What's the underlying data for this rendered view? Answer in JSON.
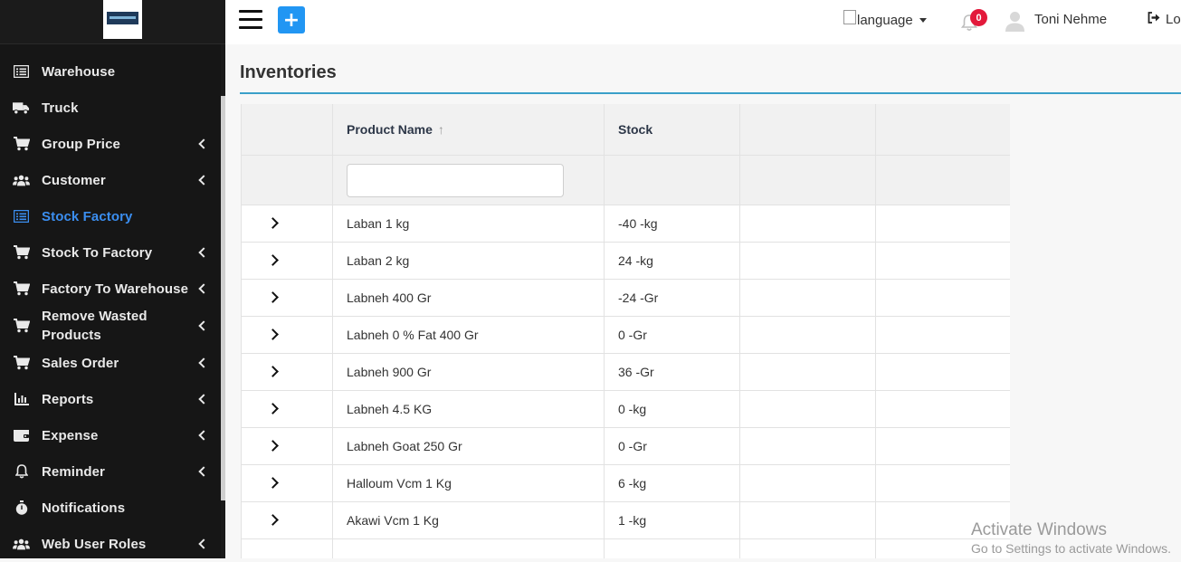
{
  "sidebar": {
    "items": [
      {
        "label": "Warehouse",
        "icon": "warehouse-icon",
        "has_submenu": false,
        "active": false
      },
      {
        "label": "Truck",
        "icon": "truck-icon",
        "has_submenu": false,
        "active": false
      },
      {
        "label": "Group Price",
        "icon": "cart-icon",
        "has_submenu": true,
        "active": false
      },
      {
        "label": "Customer",
        "icon": "users-icon",
        "has_submenu": true,
        "active": false
      },
      {
        "label": "Stock Factory",
        "icon": "list-icon",
        "has_submenu": false,
        "active": true
      },
      {
        "label": "Stock To Factory",
        "icon": "cart-icon",
        "has_submenu": true,
        "active": false
      },
      {
        "label": "Factory To Warehouse",
        "icon": "cart-icon",
        "has_submenu": true,
        "active": false
      },
      {
        "label": "Remove Wasted Products",
        "icon": "cart-icon",
        "has_submenu": true,
        "active": false
      },
      {
        "label": "Sales Order",
        "icon": "cart-icon",
        "has_submenu": true,
        "active": false
      },
      {
        "label": "Reports",
        "icon": "chart-icon",
        "has_submenu": true,
        "active": false
      },
      {
        "label": "Expense",
        "icon": "wallet-icon",
        "has_submenu": true,
        "active": false
      },
      {
        "label": "Reminder",
        "icon": "bell-icon",
        "has_submenu": true,
        "active": false
      },
      {
        "label": "Notifications",
        "icon": "stopwatch-icon",
        "has_submenu": false,
        "active": false
      },
      {
        "label": "Web User Roles",
        "icon": "users-icon",
        "has_submenu": true,
        "active": false
      }
    ]
  },
  "header": {
    "add_label": "+",
    "language_alt": "language",
    "notification_count": "0",
    "username": "Toni Nehme",
    "logout_label": "Lo"
  },
  "page": {
    "title": "Inventories"
  },
  "table": {
    "columns": [
      "",
      "Product Name",
      "Stock",
      "",
      ""
    ],
    "sort_indicator": "↑",
    "filter_value": "",
    "rows": [
      {
        "name": "Laban 1 kg",
        "stock": "-40 -kg"
      },
      {
        "name": "Laban 2 kg",
        "stock": "24 -kg"
      },
      {
        "name": "Labneh 400 Gr",
        "stock": "-24 -Gr"
      },
      {
        "name": "Labneh 0 % Fat 400 Gr",
        "stock": "0 -Gr"
      },
      {
        "name": "Labneh 900 Gr",
        "stock": "36 -Gr"
      },
      {
        "name": "Labneh 4.5 KG",
        "stock": "0 -kg"
      },
      {
        "name": "Labneh Goat 250 Gr",
        "stock": "0 -Gr"
      },
      {
        "name": "Halloum Vcm 1 Kg",
        "stock": "6 -kg"
      },
      {
        "name": "Akawi Vcm 1 Kg",
        "stock": "1 -kg"
      }
    ]
  },
  "watermark": {
    "line1": "Activate Windows",
    "line2": "Go to Settings to activate Windows."
  },
  "colors": {
    "sidebar_bg": "#161616",
    "active": "#3b8ef0",
    "add_button": "#2196f3",
    "badge": "#e3193b",
    "title_underline": "#3aa0c9"
  }
}
